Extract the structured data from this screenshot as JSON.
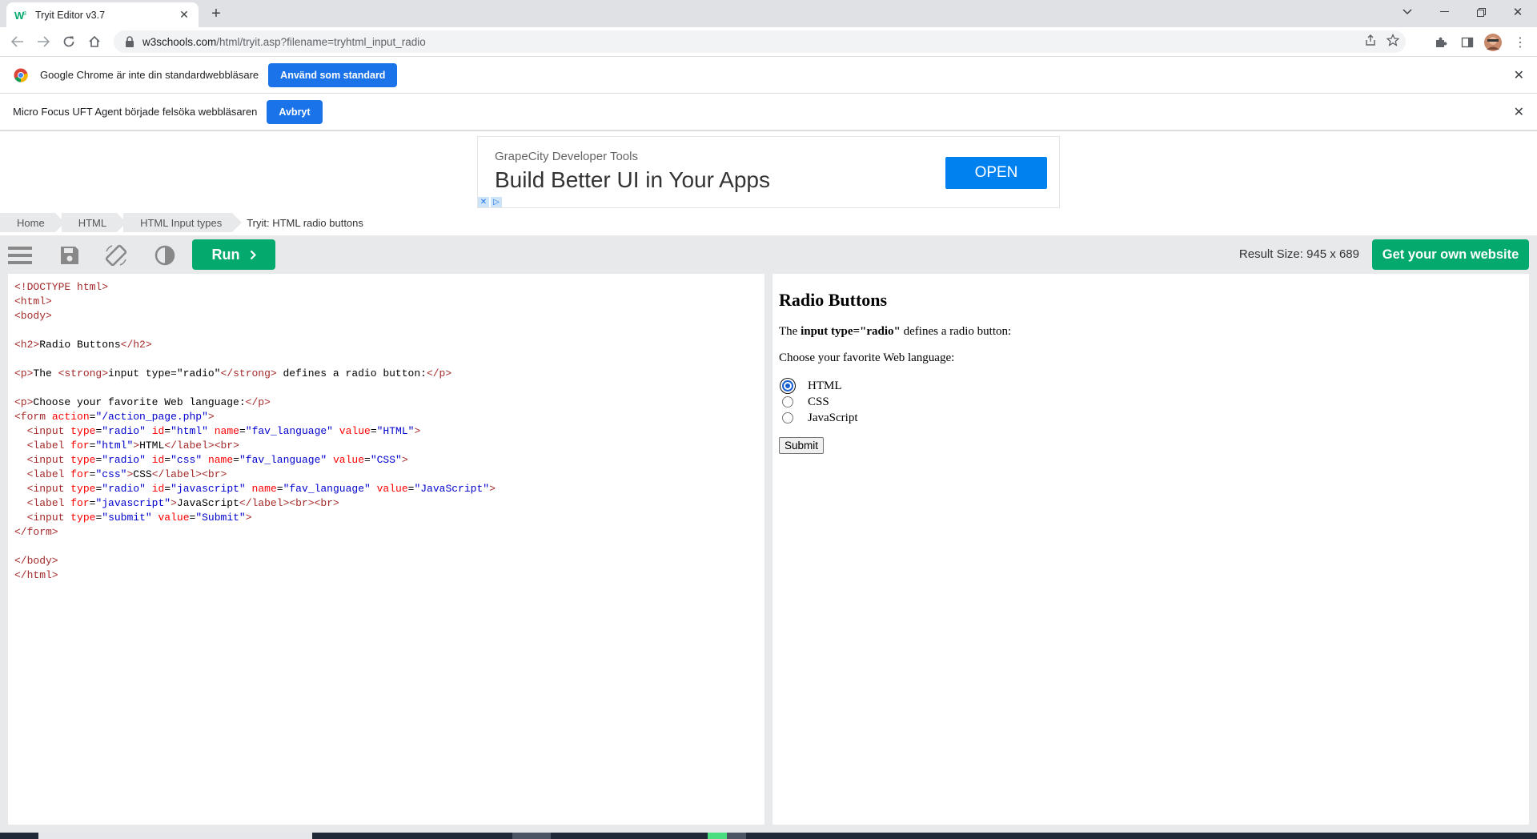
{
  "browser": {
    "tab_title": "Tryit Editor v3.7",
    "url_host": "w3schools.com",
    "url_path": "/html/tryit.asp?filename=tryhtml_input_radio"
  },
  "infobars": [
    {
      "message": "Google Chrome är inte din standardwebbläsare",
      "button": "Använd som standard"
    },
    {
      "message": "Micro Focus UFT Agent började felsöka webbläsaren",
      "button": "Avbryt"
    }
  ],
  "ad": {
    "subtitle": "GrapeCity Developer Tools",
    "headline": "Build Better UI in Your Apps",
    "button": "OPEN"
  },
  "breadcrumb": [
    "Home",
    "HTML",
    "HTML Input types",
    "Tryit: HTML radio buttons"
  ],
  "editor_toolbar": {
    "run_label": "Run",
    "result_size": "Result Size: 945 x 689",
    "get_site_label": "Get your own website"
  },
  "result": {
    "heading": "Radio Buttons",
    "intro_prefix": "The ",
    "intro_strong": "input type=\"radio\"",
    "intro_suffix": " defines a radio button:",
    "prompt": "Choose your favorite Web language:",
    "options": [
      {
        "label": "HTML",
        "checked": true
      },
      {
        "label": "CSS",
        "checked": false
      },
      {
        "label": "JavaScript",
        "checked": false
      }
    ],
    "submit_label": "Submit"
  },
  "colors": {
    "accent_green": "#04aa6d",
    "chrome_blue": "#1a73e8",
    "ad_blue": "#0081f0"
  }
}
